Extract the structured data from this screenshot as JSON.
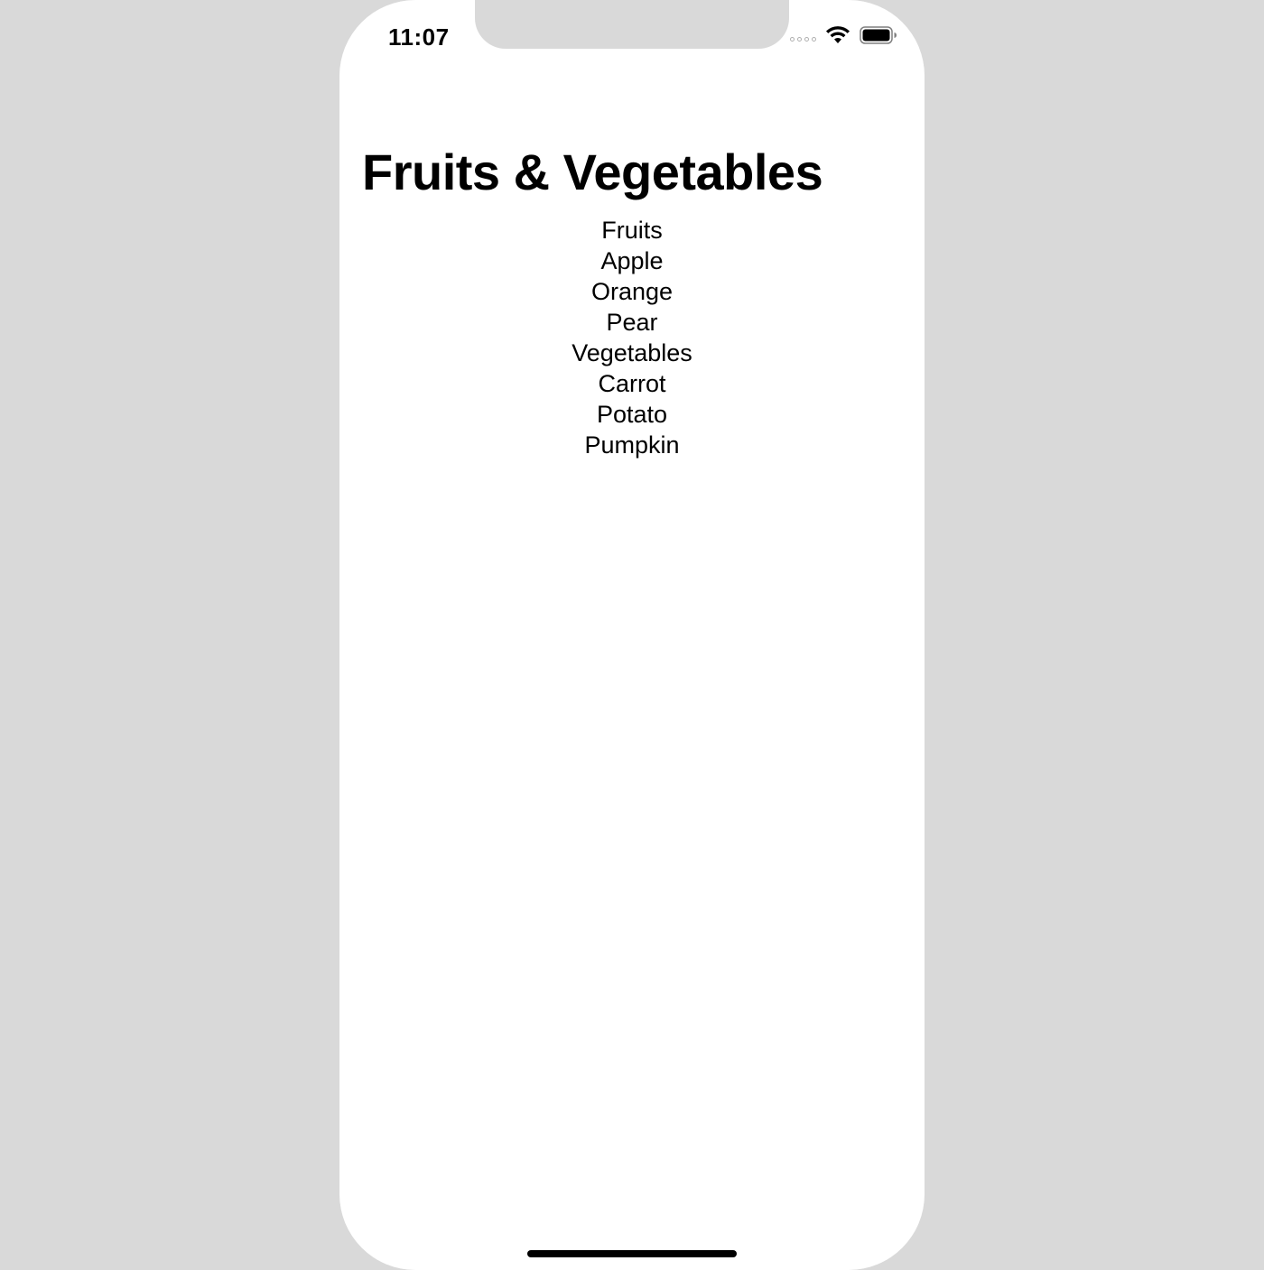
{
  "status_bar": {
    "time": "11:07",
    "wifi_icon": "wifi-icon",
    "battery_icon": "battery-icon",
    "signal_icon": "signal-dots-icon"
  },
  "screen": {
    "title": "Fruits & Vegetables",
    "items": [
      "Fruits",
      "Apple",
      "Orange",
      "Pear",
      "Vegetables",
      "Carrot",
      "Potato",
      "Pumpkin"
    ]
  },
  "colors": {
    "background": "#d9d9d9",
    "screen": "#ffffff",
    "text": "#000000"
  }
}
